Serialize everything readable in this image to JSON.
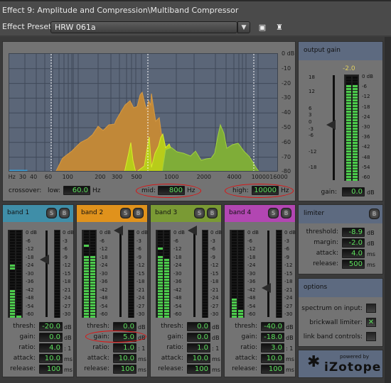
{
  "window": {
    "title": "Effect 9: Amplitude and Compression\\Multiband Compressor"
  },
  "preset": {
    "label": "Effect Preset:",
    "value": "HRW 061a",
    "save_icon": "floppy-disk-icon",
    "delete_icon": "trash-icon"
  },
  "spectrum": {
    "db_labels": [
      "0 dB",
      "-10",
      "-20",
      "-30",
      "-40",
      "-50",
      "-60",
      "-70",
      "-80"
    ],
    "hz_labels": [
      "Hz",
      "30",
      "40",
      "60",
      "100",
      "200",
      "300",
      "500",
      "1000",
      "2000",
      "4000",
      "10000",
      "16000"
    ],
    "crossover_label": "crossover:",
    "low": {
      "label": "low:",
      "value": "60.0",
      "unit": "Hz"
    },
    "mid": {
      "label": "mid:",
      "value": "800",
      "unit": "Hz"
    },
    "high": {
      "label": "high:",
      "value": "10000",
      "unit": "Hz"
    }
  },
  "output_gain": {
    "title": "output gain",
    "peak": "-2.0",
    "fader_scale": [
      "18",
      "12",
      "6",
      "3",
      "0",
      "-3",
      "-6",
      "-12",
      "-18"
    ],
    "meter_scale": [
      "0 dB",
      "-6",
      "-12",
      "-18",
      "-24",
      "-30",
      "-36",
      "-42",
      "-48",
      "-54",
      "-60"
    ],
    "gain_label": "gain:",
    "gain_value": "0.0",
    "gain_unit": "dB",
    "meter_level_fraction": 0.93
  },
  "band_meter_scale": [
    "0 dB",
    "-6",
    "-12",
    "-18",
    "-24",
    "-30",
    "-36",
    "-42",
    "-48",
    "-54",
    "-60"
  ],
  "band_gr_scale": [
    "0 dB",
    "-3",
    "-6",
    "-9",
    "-12",
    "-15",
    "-18",
    "-21",
    "-24",
    "-27",
    "-30"
  ],
  "param_labels": {
    "thresh": "thresh:",
    "gain": "gain:",
    "ratio": "ratio:",
    "attack": "attack:",
    "release": "release:"
  },
  "param_units": {
    "thresh": "dB",
    "gain": "dB",
    "ratio": ": 1",
    "attack": "ms",
    "release": "ms"
  },
  "bands": [
    {
      "name": "band 1",
      "color": "#3f8ea8",
      "solo": "S",
      "bypass": "B",
      "thresh": "-20.0",
      "gain": "0.0",
      "ratio": "4.0",
      "attack": "10.0",
      "release": "100",
      "meter_l": 0.33,
      "meter_r": 0.05,
      "peak_l": 0.6,
      "fader_db": -20
    },
    {
      "name": "band 2",
      "color": "#e0921c",
      "solo": "S",
      "bypass": "B",
      "thresh": "0.0",
      "gain": "5.0",
      "ratio": "1.0",
      "attack": "10.0",
      "release": "100",
      "meter_l": 0.72,
      "meter_r": 0.72,
      "peak_l": 0.83,
      "fader_db": 0
    },
    {
      "name": "band 3",
      "color": "#7a9a34",
      "solo": "S",
      "bypass": "B",
      "thresh": "0.0",
      "gain": "0.0",
      "ratio": "1.0",
      "attack": "10.0",
      "release": "100",
      "meter_l": 0.72,
      "meter_r": 0.68,
      "peak_l": 0.81,
      "fader_db": 0
    },
    {
      "name": "band 4",
      "color": "#b246b2",
      "solo": "S",
      "bypass": "B",
      "thresh": "-40.0",
      "gain": "-18.0",
      "ratio": "3.0",
      "attack": "10.0",
      "release": "100",
      "meter_l": 0.23,
      "meter_r": 0.12,
      "peak_l": 0.23,
      "fader_db": -40
    }
  ],
  "limiter": {
    "title": "limiter",
    "bypass": "B",
    "threshold_label": "threshold:",
    "threshold": "-8.9",
    "threshold_unit": "dB",
    "margin_label": "margin:",
    "margin": "-2.0",
    "margin_unit": "dB",
    "attack_label": "attack:",
    "attack": "4.0",
    "attack_unit": "ms",
    "release_label": "release:",
    "release": "500",
    "release_unit": "ms"
  },
  "options": {
    "title": "options",
    "items": [
      {
        "label": "spectrum on input:",
        "checked": false
      },
      {
        "label": "brickwall limiter:",
        "checked": true,
        "mark": "✕"
      },
      {
        "label": "link band controls:",
        "checked": false
      }
    ]
  },
  "logo": {
    "powered_by": "powered by",
    "brand": "iZotope"
  }
}
